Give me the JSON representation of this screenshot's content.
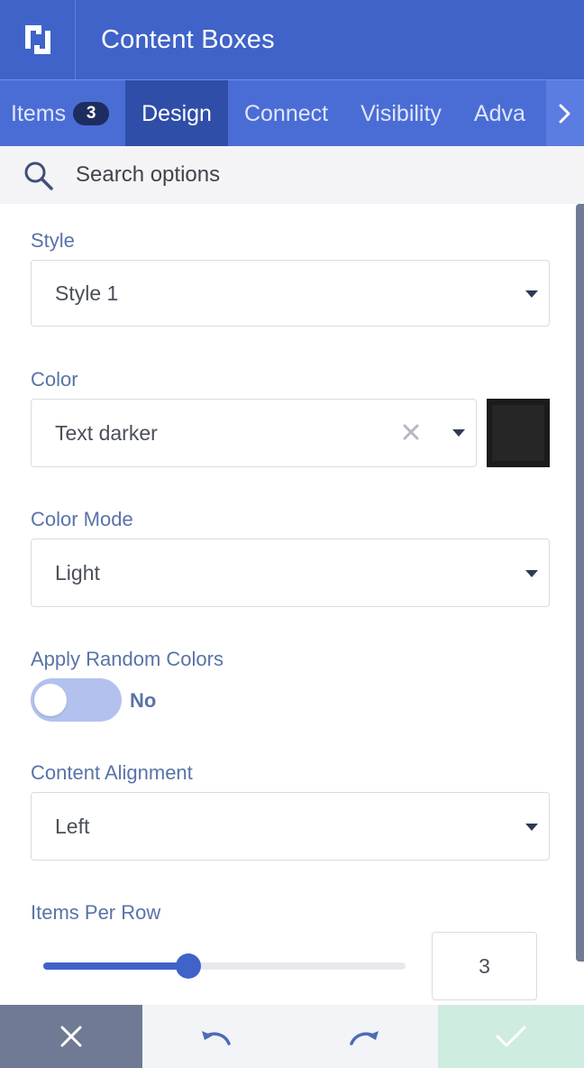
{
  "header": {
    "title": "Content Boxes",
    "logo_icon": "panel-logo-icon"
  },
  "tabs": [
    {
      "label": "Items",
      "badge": "3"
    },
    {
      "label": "Design"
    },
    {
      "label": "Connect"
    },
    {
      "label": "Visibility"
    },
    {
      "label": "Adva"
    }
  ],
  "active_tab": "Design",
  "search": {
    "placeholder": "Search options",
    "value": ""
  },
  "fields": {
    "style": {
      "label": "Style",
      "value": "Style 1"
    },
    "color": {
      "label": "Color",
      "value": "Text darker",
      "swatch": "#262626"
    },
    "color_mode": {
      "label": "Color Mode",
      "value": "Light"
    },
    "random_colors": {
      "label": "Apply Random Colors",
      "state_text": "No"
    },
    "alignment": {
      "label": "Content Alignment",
      "value": "Left"
    },
    "items_per_row": {
      "label": "Items Per Row",
      "value": "3",
      "fraction": 0.4
    }
  },
  "footer": {
    "cancel_icon": "close-icon",
    "undo_icon": "undo-icon",
    "redo_icon": "redo-icon",
    "apply_icon": "check-icon"
  },
  "colors": {
    "accent": "#3f63c9",
    "tab_active": "#2f4ea8",
    "label": "#5973a8",
    "apply": "#cfece0",
    "cancel": "#707a94"
  }
}
